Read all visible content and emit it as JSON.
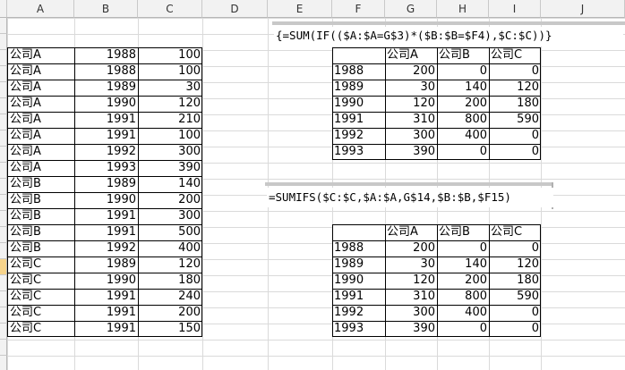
{
  "columns": [
    "A",
    "B",
    "C",
    "D",
    "E",
    "F",
    "G",
    "H",
    "I",
    "J"
  ],
  "source_rows": [
    [
      "公司A",
      "1988",
      "100"
    ],
    [
      "公司A",
      "1988",
      "100"
    ],
    [
      "公司A",
      "1989",
      "30"
    ],
    [
      "公司A",
      "1990",
      "120"
    ],
    [
      "公司A",
      "1991",
      "210"
    ],
    [
      "公司A",
      "1991",
      "100"
    ],
    [
      "公司A",
      "1992",
      "300"
    ],
    [
      "公司A",
      "1993",
      "390"
    ],
    [
      "公司B",
      "1989",
      "140"
    ],
    [
      "公司B",
      "1990",
      "200"
    ],
    [
      "公司B",
      "1991",
      "300"
    ],
    [
      "公司B",
      "1991",
      "500"
    ],
    [
      "公司B",
      "1992",
      "400"
    ],
    [
      "公司C",
      "1989",
      "120"
    ],
    [
      "公司C",
      "1990",
      "180"
    ],
    [
      "公司C",
      "1991",
      "240"
    ],
    [
      "公司C",
      "1991",
      "200"
    ],
    [
      "公司C",
      "1991",
      "150"
    ]
  ],
  "formula1": "{=SUM(IF(($A:$A=G$3)*($B:$B=$F4),$C:$C))}",
  "formula2": "=SUMIFS($C:$C,$A:$A,G$14,$B:$B,$F15)",
  "summary_header": [
    "公司A",
    "公司B",
    "公司C"
  ],
  "summary_rows": [
    [
      "1988",
      "200",
      "0",
      "0"
    ],
    [
      "1989",
      "30",
      "140",
      "120"
    ],
    [
      "1990",
      "120",
      "200",
      "180"
    ],
    [
      "1991",
      "310",
      "800",
      "590"
    ],
    [
      "1992",
      "300",
      "400",
      "0"
    ],
    [
      "1993",
      "390",
      "0",
      "0"
    ]
  ]
}
